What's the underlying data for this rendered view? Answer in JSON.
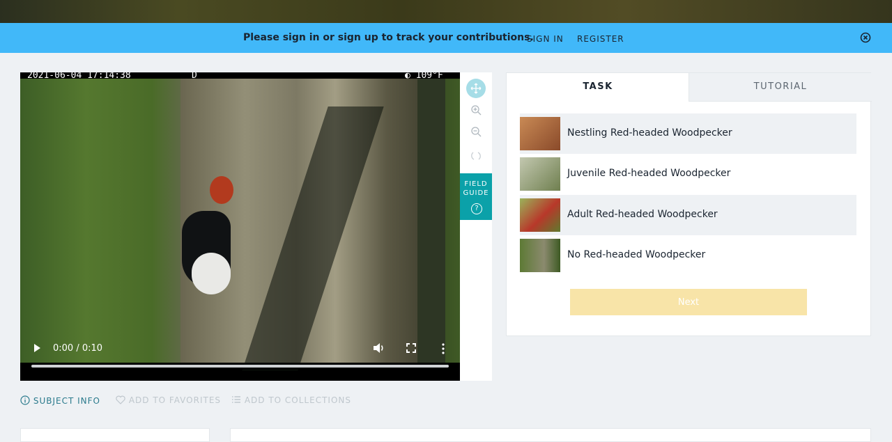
{
  "banner": {
    "message": "Please sign in or sign up to track your contributions.",
    "sign_in": "SIGN IN",
    "register": "REGISTER",
    "close_icon": "close-circle-icon"
  },
  "video": {
    "timestamp_left": "2021-06-04 17:14:38",
    "timestamp_mid": "D",
    "temperature": "◐ 109°F",
    "time_display": "0:00 / 0:10",
    "progress": 0,
    "icons": [
      "play-icon",
      "volume-icon",
      "fullscreen-icon",
      "more-vertical-icon"
    ]
  },
  "tools": {
    "icons": [
      "move-icon",
      "zoom-in-icon",
      "zoom-out-icon",
      "rotate-icon"
    ],
    "field_guide": "FIELD GUIDE",
    "field_guide_help": "?"
  },
  "panel": {
    "tabs": [
      {
        "label": "TASK",
        "active": true
      },
      {
        "label": "TUTORIAL",
        "active": false
      }
    ],
    "choices": [
      {
        "label": "Nestling Red-headed Woodpecker",
        "thumb_color": "#a0623a"
      },
      {
        "label": "Juvenile Red-headed Woodpecker",
        "thumb_color": "#8a9a6a"
      },
      {
        "label": "Adult Red-headed Woodpecker",
        "thumb_color": "#6f8a3a"
      },
      {
        "label": "No Red-headed Woodpecker",
        "thumb_color": "#4c6a2c"
      }
    ],
    "next": "Next"
  },
  "meta_actions": {
    "subject_info": "SUBJECT INFO",
    "add_favorites": "ADD TO FAVORITES",
    "add_collections": "ADD TO COLLECTIONS"
  },
  "colors": {
    "banner": "#41b8f9",
    "accent": "#0ba1a9",
    "next_disabled": "#f8e4a8"
  }
}
